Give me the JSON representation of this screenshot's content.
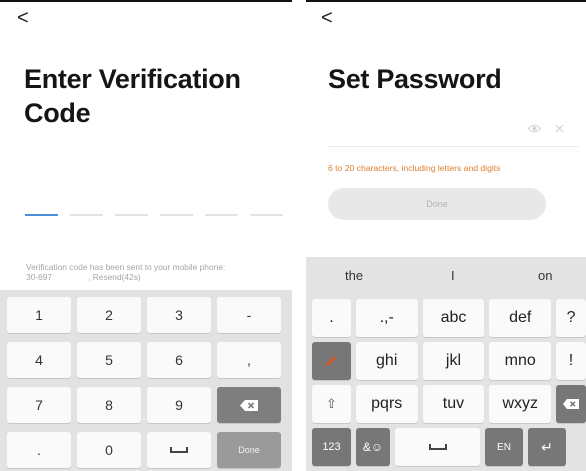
{
  "left": {
    "back": "<",
    "title": "Enter Verification Code",
    "code_slot_count": 6,
    "hint_line1": "Verification code has been sent to your mobile phone:",
    "hint_phone": "30-697",
    "hint_resend": ", Resend(42s)",
    "keys": [
      "1",
      "2",
      "3",
      "-",
      "4",
      "5",
      "6",
      ",",
      "7",
      "8",
      "9",
      "",
      ".",
      "0",
      "",
      "Done"
    ]
  },
  "right": {
    "back": "<",
    "title": "Set Password",
    "password_hint": "6 to 20 characters, including letters and digits",
    "done_label": "Done",
    "suggestions": [
      "the",
      "I",
      "on"
    ],
    "row1": [
      ".",
      ".,-",
      "abc",
      "def",
      "?"
    ],
    "row2": [
      "",
      "ghi",
      "jkl",
      "mno",
      "!"
    ],
    "row3": [
      "⇧",
      "pqrs",
      "tuv",
      "wxyz",
      ""
    ],
    "row4": [
      "123",
      "&☺",
      "",
      "EN",
      "↵"
    ]
  },
  "colors": {
    "accent": "#4a90d9",
    "hint_orange": "#e0802f",
    "pen_icon": "#d9531e"
  }
}
